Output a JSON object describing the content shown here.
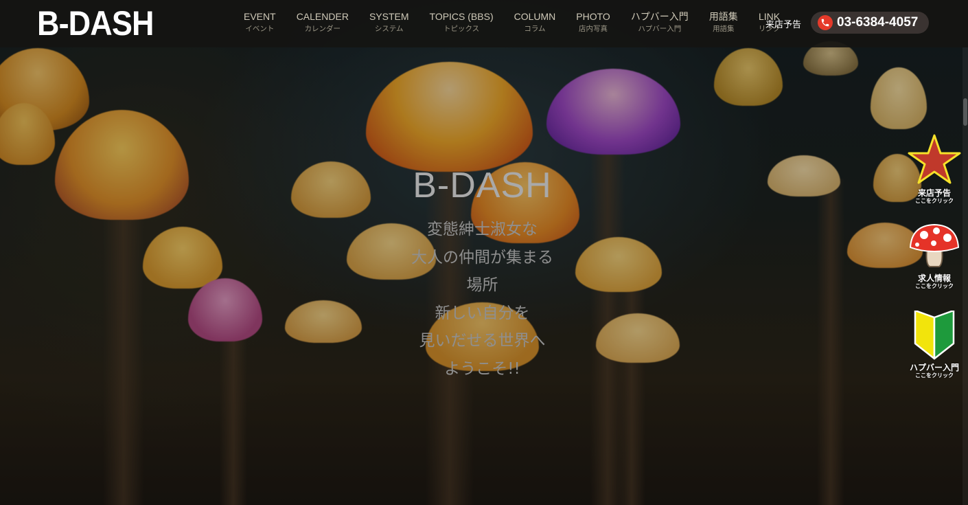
{
  "header": {
    "logo": "B-DASH",
    "nav": [
      {
        "en": "EVENT",
        "ja": "イベント"
      },
      {
        "en": "CALENDER",
        "ja": "カレンダー"
      },
      {
        "en": "SYSTEM",
        "ja": "システム"
      },
      {
        "en": "TOPICS (BBS)",
        "ja": "トピックス"
      },
      {
        "en": "COLUMN",
        "ja": "コラム"
      },
      {
        "en": "PHOTO",
        "ja": "店内写真"
      },
      {
        "en": "ハプバー入門",
        "ja": "ハプバー入門"
      },
      {
        "en": "用語集",
        "ja": "用語集"
      },
      {
        "en": "LINK",
        "ja": "リンク"
      }
    ],
    "reserve_label": "来店予告",
    "phone": "03-6384-4057"
  },
  "hero": {
    "title": "B-DASH",
    "lines": [
      "変態紳士淑女な",
      "大人の仲間が集まる",
      "場所",
      "新しい自分を",
      "見いだせる世界へ",
      "ようこそ!!"
    ]
  },
  "side_buttons": [
    {
      "label": "来店予告",
      "sub": "ここをクリック",
      "icon": "star-icon"
    },
    {
      "label": "求人情報",
      "sub": "ここをクリック",
      "icon": "mushroom-icon"
    },
    {
      "label": "ハプバー入門",
      "sub": "ここをクリック",
      "icon": "beginner-mark-icon"
    }
  ],
  "colors": {
    "header_bg": "#141412",
    "phone_icon": "#e53a2a",
    "star": "#c0392b",
    "star_outline": "#f5e12a",
    "beginner_green": "#1e9a3c",
    "beginner_yellow": "#f2e40c"
  }
}
